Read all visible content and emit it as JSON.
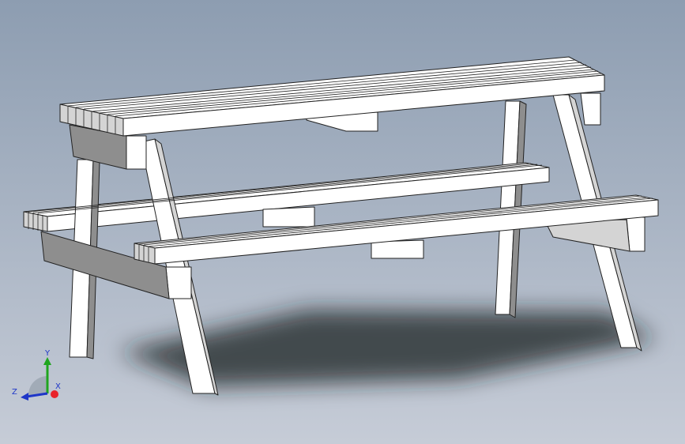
{
  "viewport": {
    "background_top": "#8d9db1",
    "background_bottom": "#c6ccd7"
  },
  "model": {
    "part_fill": "#ffffff",
    "edge_color": "#222222",
    "shade_light": "#d4d4d4",
    "shade_dark": "#8e8e8e",
    "shadow_color": "#1c1f24"
  },
  "triad": {
    "x_label": "X",
    "y_label": "Y",
    "z_label": "Z",
    "x_color": "#e8232a",
    "y_color": "#1fa51f",
    "z_color": "#1e36c8"
  }
}
